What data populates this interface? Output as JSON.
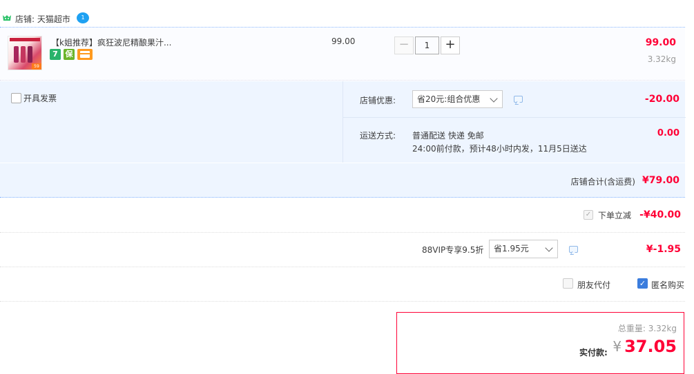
{
  "shop": {
    "label": "店铺: 天猫超市",
    "wangwang_badge": "1"
  },
  "item": {
    "title": "【k姐推荐】疯狂波尼精酿果汁...",
    "unit_price": "99.00",
    "quantity": "1",
    "subtotal": "99.00",
    "weight": "3.32kg",
    "thumb_badge": "59",
    "tags": [
      {
        "icon": "seven-day-return-icon",
        "text": "7",
        "color": "#29b36b"
      },
      {
        "icon": "guarantee-icon",
        "text": "保",
        "color": "#6bb42a"
      },
      {
        "icon": "credit-card-icon",
        "text": "",
        "color": "#ff9a1f"
      }
    ]
  },
  "invoice": {
    "label": "开具发票",
    "checked": false
  },
  "shop_discount": {
    "label": "店铺优惠:",
    "selected": "省20元:组合优惠",
    "amount": "-20.00"
  },
  "shipping": {
    "label": "运送方式:",
    "line1": "普通配送 快递 免邮",
    "line2": "24:00前付款，预计48小时内发，11月5日送达",
    "amount": "0.00"
  },
  "shop_total": {
    "label": "店铺合计(含运费)",
    "amount": "¥79.00"
  },
  "instant_discount": {
    "label": "下单立减",
    "amount": "-¥40.00",
    "checked": true
  },
  "vip": {
    "label": "88VIP专享9.5折",
    "selected": "省1.95元",
    "amount": "¥-1.95"
  },
  "options": {
    "friend_pay_label": "朋友代付",
    "friend_pay_checked": false,
    "anonymous_label": "匿名购买",
    "anonymous_checked": true
  },
  "payment": {
    "total_weight_label": "总重量: 3.32kg",
    "label": "实付款:",
    "currency": "¥",
    "amount": "37.05"
  },
  "colors": {
    "accent_red": "#ff0036",
    "light_blue_bg": "#eef5ff",
    "check_blue": "#3b7ddd"
  }
}
